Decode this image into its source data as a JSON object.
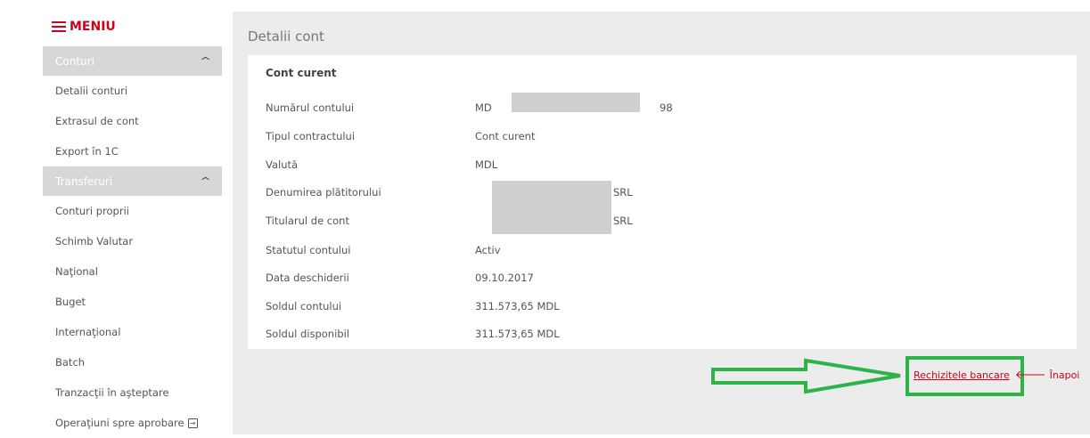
{
  "menu": {
    "label": "MENIU"
  },
  "sidebar": {
    "sections": [
      {
        "title": "Conturi",
        "items": [
          "Detalii conturi",
          "Extrasul de cont",
          "Export în 1C"
        ]
      },
      {
        "title": "Transferuri",
        "items": [
          "Conturi proprii",
          "Schimb Valutar",
          "Naţional",
          "Buget",
          "Internaţional",
          "Batch",
          "Tranzacţii în aşteptare",
          "Operaţiuni spre aprobare"
        ]
      }
    ]
  },
  "page": {
    "title": "Detalii cont"
  },
  "account": {
    "card_title": "Cont curent",
    "rows": [
      {
        "label": "Numărul contului",
        "value_prefix": "MD",
        "value_suffix": "98"
      },
      {
        "label": "Tipul contractului",
        "value": "Cont curent"
      },
      {
        "label": "Valută",
        "value": "MDL"
      },
      {
        "label": "Denumirea plătitorului",
        "value": "SRL"
      },
      {
        "label": "Titularul de cont",
        "value": "SRL"
      },
      {
        "label": "Statutul contului",
        "value": "Activ"
      },
      {
        "label": "Data deschiderii",
        "value": "09.10.2017"
      },
      {
        "label": "Soldul contului",
        "value": "311.573,65 MDL"
      },
      {
        "label": "Soldul disponibil",
        "value": "311.573,65 MDL"
      }
    ]
  },
  "actions": {
    "requisites": "Rechizitele bancare",
    "back": "Înapoi"
  },
  "colors": {
    "accent": "#d0021b",
    "highlight": "#2db34a",
    "section_bg": "#d7d7d7"
  }
}
